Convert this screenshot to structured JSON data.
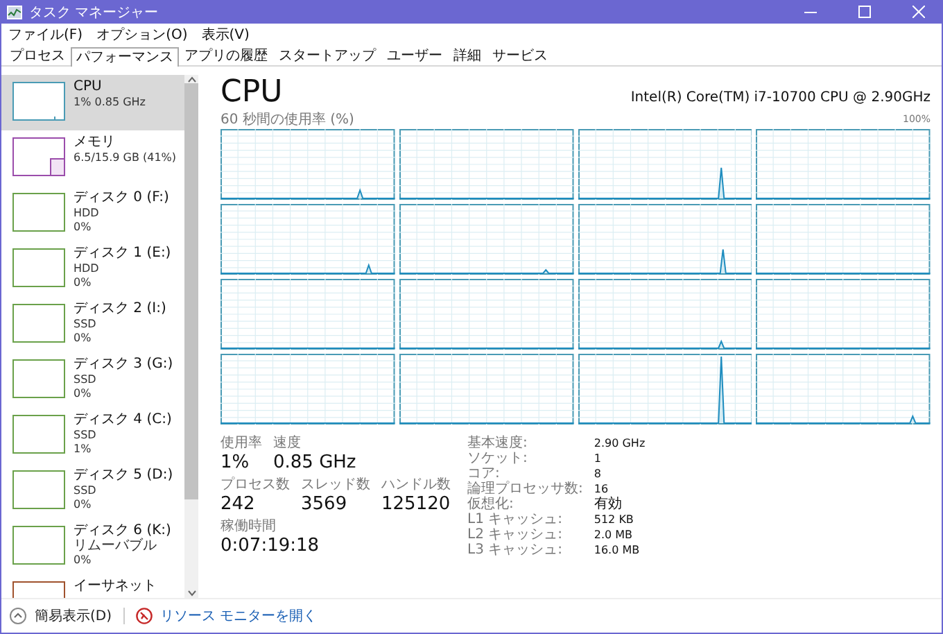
{
  "window": {
    "title": "タスク マネージャー"
  },
  "menu": [
    "ファイル(F)",
    "オプション(O)",
    "表示(V)"
  ],
  "tabs": [
    {
      "label": "プロセス",
      "selected": false
    },
    {
      "label": "パフォーマンス",
      "selected": true
    },
    {
      "label": "アプリの履歴",
      "selected": false
    },
    {
      "label": "スタートアップ",
      "selected": false
    },
    {
      "label": "ユーザー",
      "selected": false
    },
    {
      "label": "詳細",
      "selected": false
    },
    {
      "label": "サービス",
      "selected": false
    }
  ],
  "sidebar": {
    "items": [
      {
        "kind": "cpu",
        "label": "CPU",
        "lines": [
          "1% 0.85 GHz"
        ],
        "selected": true
      },
      {
        "kind": "memory",
        "label": "メモリ",
        "lines": [
          "6.5/15.9 GB (41%)"
        ],
        "selected": false
      },
      {
        "kind": "disk",
        "label": "ディスク 0 (F:)",
        "lines": [
          "HDD",
          "0%"
        ],
        "selected": false
      },
      {
        "kind": "disk",
        "label": "ディスク 1 (E:)",
        "lines": [
          "HDD",
          "0%"
        ],
        "selected": false
      },
      {
        "kind": "disk",
        "label": "ディスク 2 (I:)",
        "lines": [
          "SSD",
          "0%"
        ],
        "selected": false
      },
      {
        "kind": "disk",
        "label": "ディスク 3 (G:)",
        "lines": [
          "SSD",
          "0%"
        ],
        "selected": false
      },
      {
        "kind": "disk",
        "label": "ディスク 4 (C:)",
        "lines": [
          "SSD",
          "1%"
        ],
        "selected": false
      },
      {
        "kind": "disk",
        "label": "ディスク 5 (D:)",
        "lines": [
          "SSD",
          "0%"
        ],
        "selected": false
      },
      {
        "kind": "disk",
        "label": "ディスク 6 (K:)",
        "lines": [
          "リムーバブル",
          "0%"
        ],
        "selected": false
      },
      {
        "kind": "network",
        "label": "イーサネット",
        "selected": false
      }
    ]
  },
  "main": {
    "title": "CPU",
    "model": "Intel(R) Core(TM) i7-10700 CPU @ 2.90GHz",
    "graph_caption": "60 秒間の使用率 (%)",
    "graph_max": "100%",
    "stats": [
      [
        {
          "label": "使用率",
          "value": "1%"
        },
        {
          "label": "速度",
          "value": "0.85 GHz"
        }
      ],
      [
        {
          "label": "プロセス数",
          "value": "242"
        },
        {
          "label": "スレッド数",
          "value": "3569"
        },
        {
          "label": "ハンドル数",
          "value": "125120"
        }
      ],
      [
        {
          "label": "稼働時間",
          "value": "0:07:19:18"
        }
      ]
    ],
    "details": [
      {
        "label": "基本速度:",
        "value": "2.90 GHz"
      },
      {
        "label": "ソケット:",
        "value": "1"
      },
      {
        "label": "コア:",
        "value": "8"
      },
      {
        "label": "論理プロセッサ数:",
        "value": "16"
      },
      {
        "label": "仮想化:",
        "value": "有効"
      },
      {
        "label": "L1 キャッシュ:",
        "value": "512 KB"
      },
      {
        "label": "L2 キャッシュ:",
        "value": "2.0 MB"
      },
      {
        "label": "L3 キャッシュ:",
        "value": "16.0 MB"
      }
    ]
  },
  "footer": {
    "fewer_details": "簡易表示(D)",
    "resource_monitor": "リソース モニターを開く"
  }
}
